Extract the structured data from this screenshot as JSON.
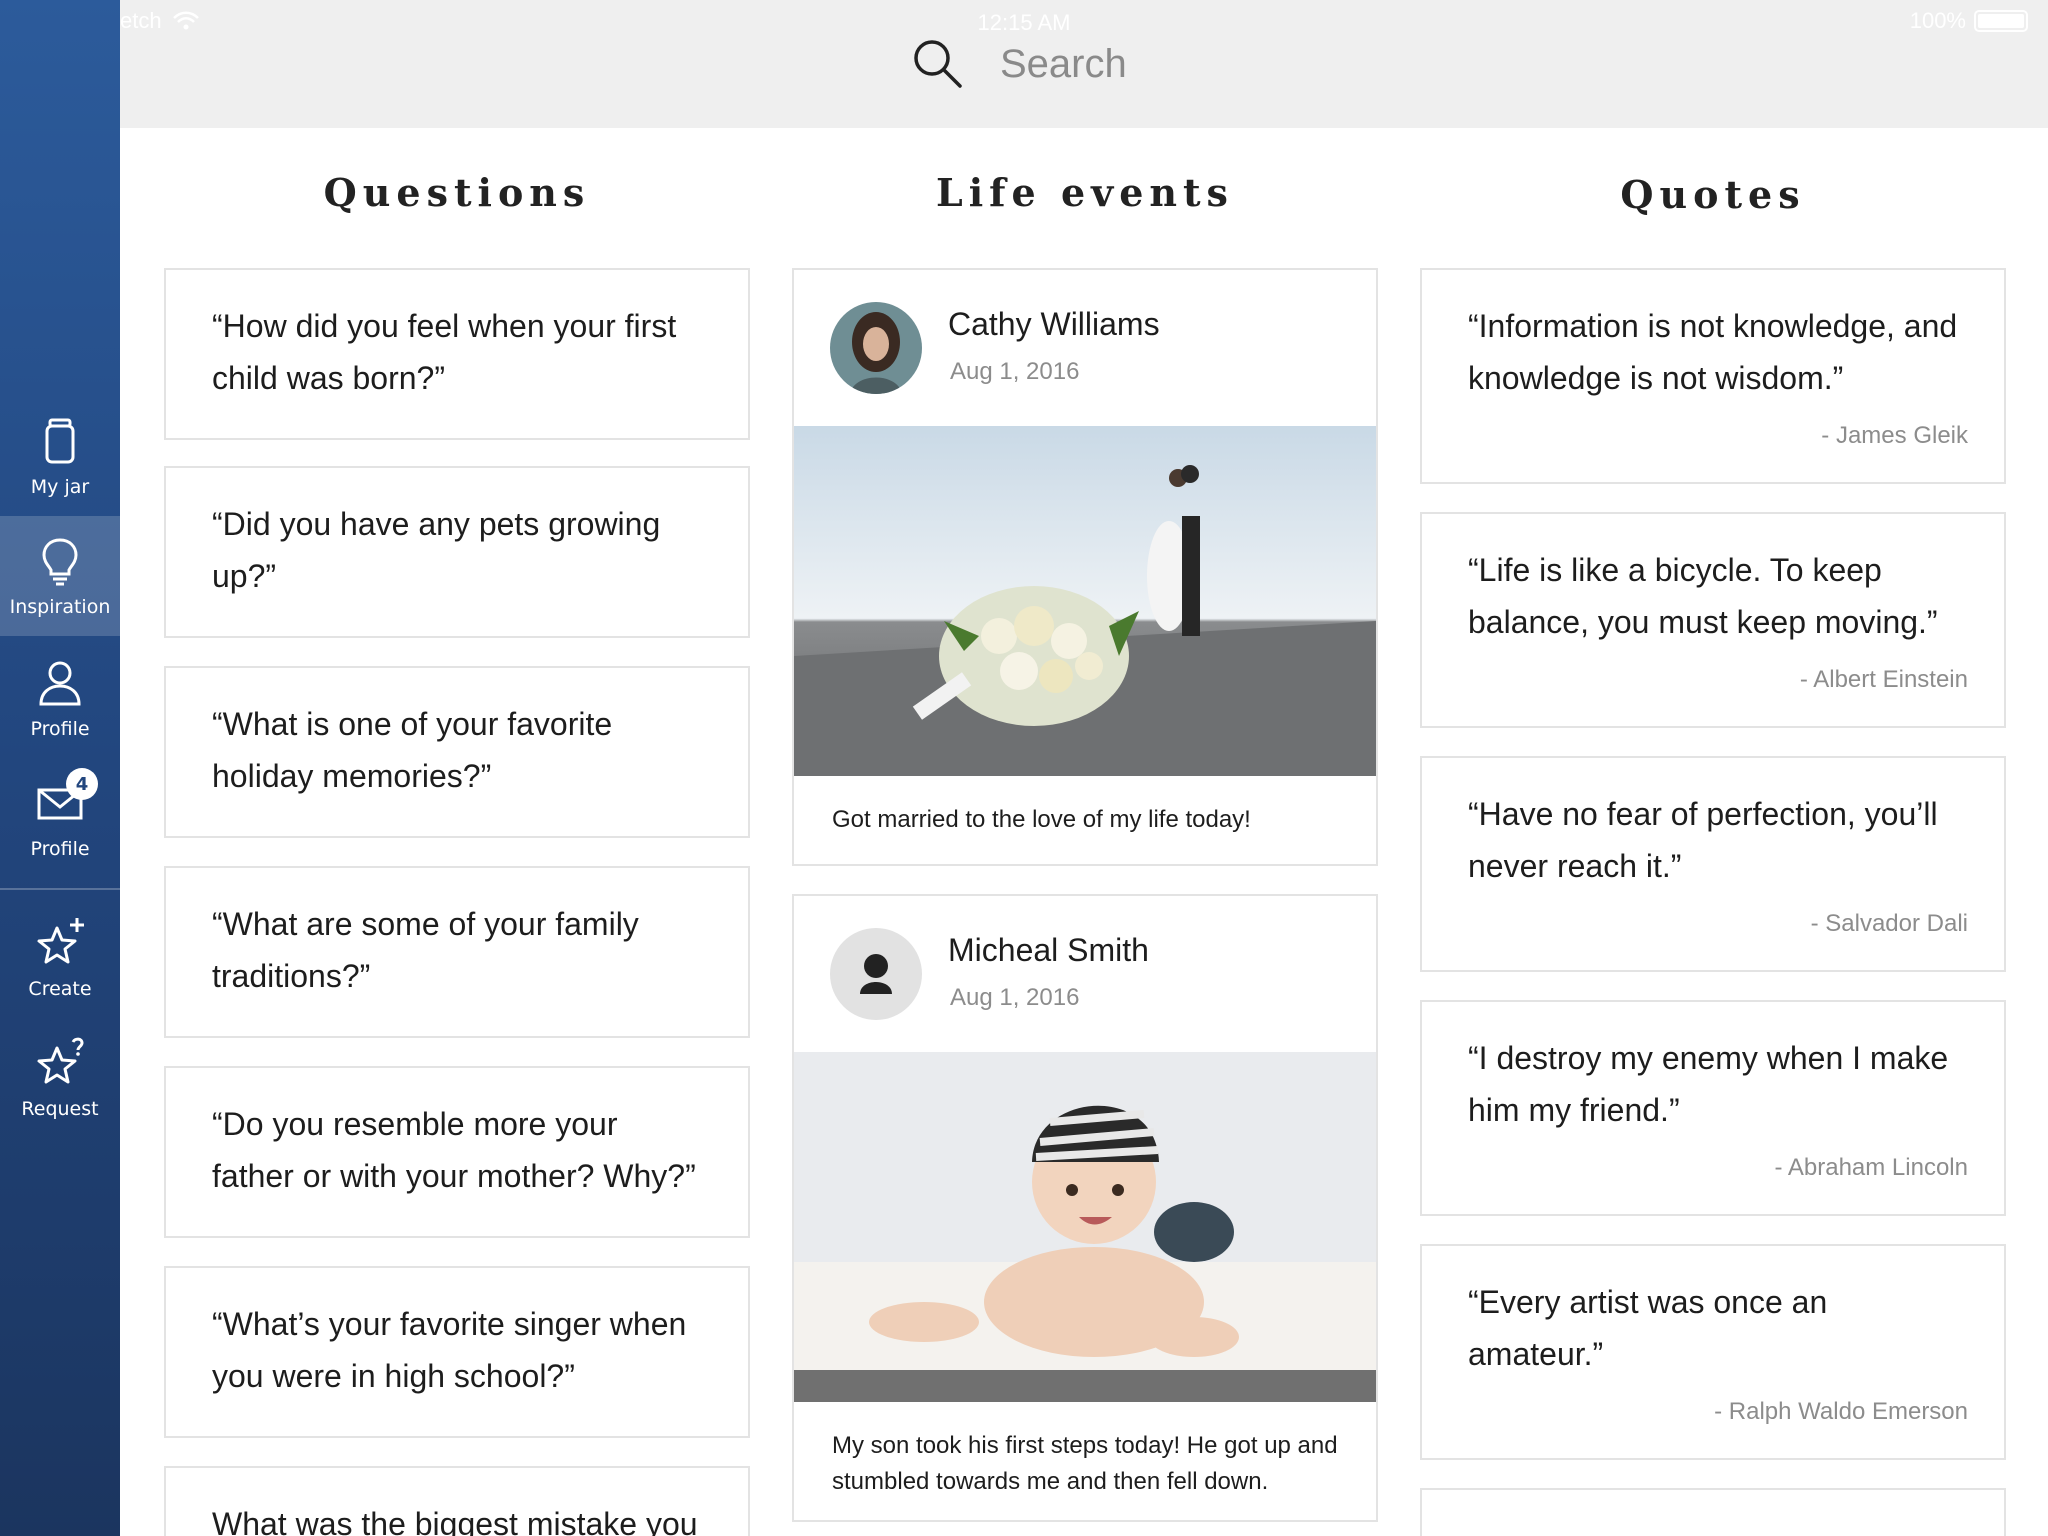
{
  "status": {
    "carrier": "etch",
    "time": "12:15 AM",
    "battery": "100%"
  },
  "search": {
    "placeholder": "Search"
  },
  "sidebar": {
    "items": [
      {
        "label": "My jar",
        "icon": "jar-icon"
      },
      {
        "label": "Inspiration",
        "icon": "lightbulb-icon",
        "active": true
      },
      {
        "label": "Profile",
        "icon": "person-icon"
      },
      {
        "label": "Profile",
        "icon": "mail-icon",
        "badge": "4"
      },
      {
        "label": "Create",
        "icon": "star-plus-icon"
      },
      {
        "label": "Request",
        "icon": "star-question-icon"
      }
    ]
  },
  "columns": {
    "questions": "Questions",
    "life_events": "Life events",
    "quotes": "Quotes"
  },
  "questions": [
    "“How did you feel when your first child was born?”",
    "“Did you have any pets growing up?”",
    "“What is one of your favorite holiday memories?”",
    "“What are some of your family traditions?”",
    "“Do you resemble more your father or with your mother? Why?”",
    "“What’s your favorite singer when you were in high school?”",
    "What was the biggest mistake you"
  ],
  "events": [
    {
      "name": "Cathy Williams",
      "date": "Aug 1, 2016",
      "caption": "Got married to the love of my life today!"
    },
    {
      "name": "Micheal Smith",
      "date": "Aug 1, 2016",
      "caption": "My son took his first steps today! He got up and stumbled towards me and then fell down."
    }
  ],
  "quotes": [
    {
      "text": "“Information is not knowledge, and knowledge is not wisdom.”",
      "author": "- James Gleik"
    },
    {
      "text": "“Life is like a bicycle. To keep balance, you must keep moving.”",
      "author": "- Albert Einstein"
    },
    {
      "text": "“Have no fear of perfection, you’ll never reach it.”",
      "author": "- Salvador Dali"
    },
    {
      "text": "“I destroy my enemy when I make him my friend.”",
      "author": "- Abraham Lincoln"
    },
    {
      "text": "“Every artist was once an amateur.”",
      "author": "- Ralph Waldo Emerson"
    }
  ],
  "colors": {
    "sidebar": "#22467e",
    "topbar": "#efefef",
    "card_border": "#e3e3e3"
  }
}
